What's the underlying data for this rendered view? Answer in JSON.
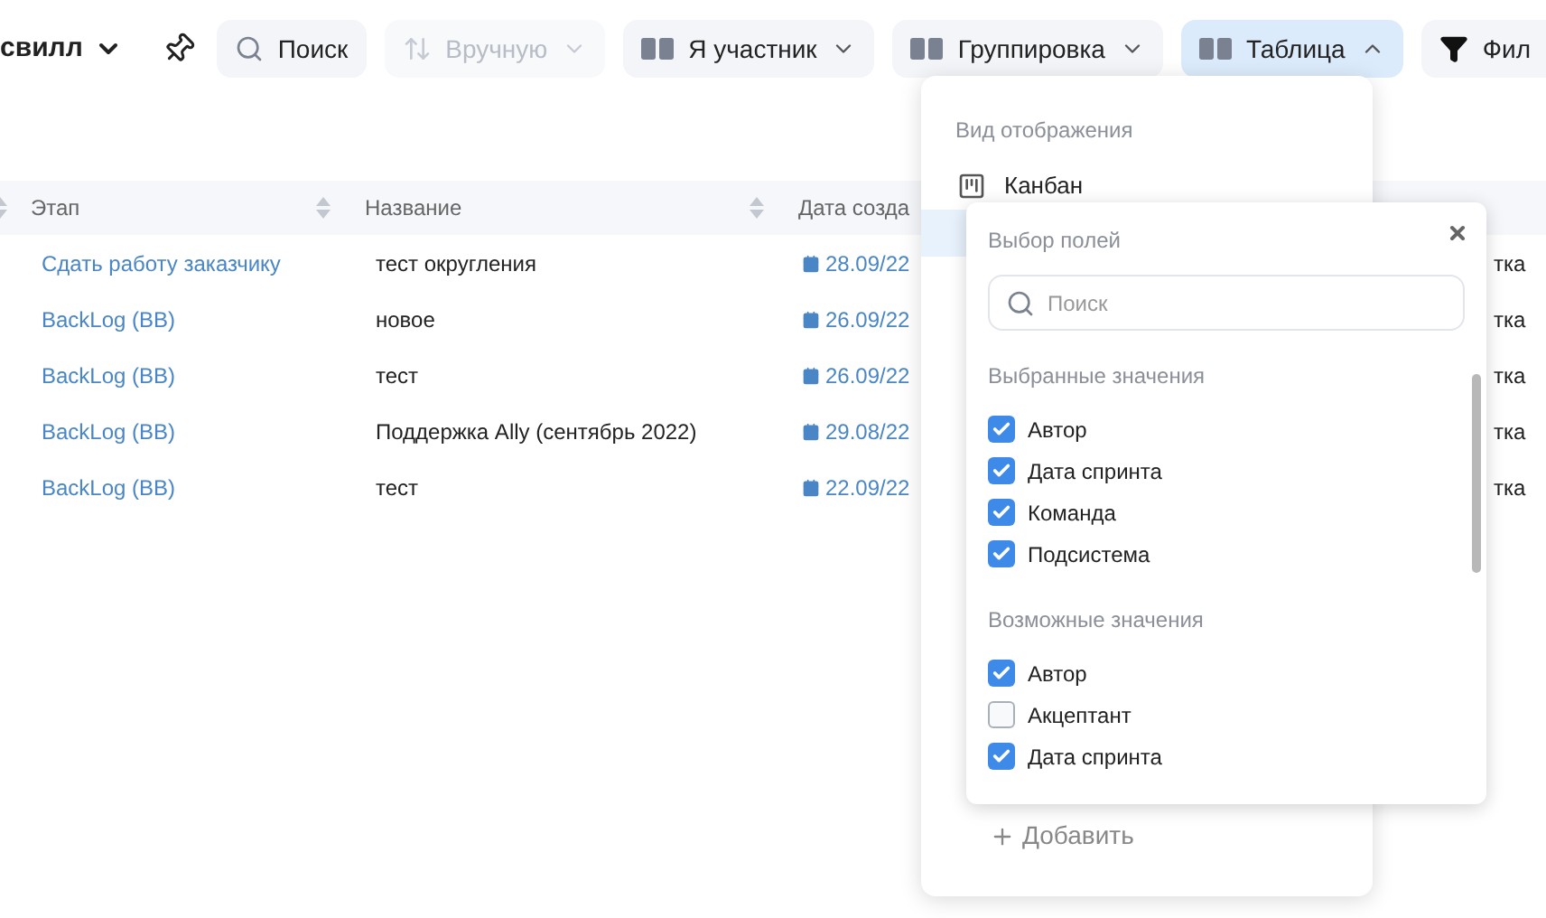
{
  "toolbar": {
    "title": "свилл",
    "buttons": [
      {
        "kind": "search",
        "label": "Поиск",
        "active": false,
        "disabled": false
      },
      {
        "kind": "sort",
        "label": "Вручную",
        "active": false,
        "disabled": true
      },
      {
        "kind": "grid",
        "label": "Я участник",
        "active": false,
        "disabled": false
      },
      {
        "kind": "grid",
        "label": "Группировка",
        "active": false,
        "disabled": false
      },
      {
        "kind": "grid",
        "label": "Таблица",
        "active": true,
        "disabled": false
      },
      {
        "kind": "filter",
        "label": "Фил",
        "active": false,
        "disabled": false
      }
    ]
  },
  "table": {
    "columns": [
      "Этап",
      "Название",
      "Дата созда"
    ],
    "rows": [
      {
        "stage": "Сдать работу заказчику",
        "name": "тест округления",
        "date": "28.09/22",
        "column_4": "тка"
      },
      {
        "stage": "BackLog (BB)",
        "name": "новое",
        "date": "26.09/22",
        "column_4": "тка"
      },
      {
        "stage": "BackLog (BB)",
        "name": "тест",
        "date": "26.09/22",
        "column_4": "тка"
      },
      {
        "stage": "BackLog (BB)",
        "name": "Поддержка Ally (сентябрь 2022)",
        "date": "29.08/22",
        "column_4": "тка"
      },
      {
        "stage": "BackLog (BB)",
        "name": "тест",
        "date": "22.09/22",
        "column_4": "тка"
      }
    ]
  },
  "view_menu": {
    "title": "Вид отображения",
    "items": [
      {
        "label": "Канбан",
        "selected": false
      },
      {
        "selected": true
      }
    ],
    "add_label": "Добавить"
  },
  "field_picker": {
    "title": "Выбор полей",
    "search": {
      "placeholder": "Поиск"
    },
    "sections": [
      {
        "title": "Выбранные значения",
        "items": [
          {
            "label": "Автор",
            "checked": true
          },
          {
            "label": "Дата спринта",
            "checked": true
          },
          {
            "label": "Команда",
            "checked": true
          },
          {
            "label": "Подсистема",
            "checked": true
          }
        ]
      },
      {
        "title": "Возможные значения",
        "items": [
          {
            "label": "Автор",
            "checked": true
          },
          {
            "label": "Акцептант",
            "checked": false
          },
          {
            "label": "Дата спринта",
            "checked": true
          }
        ]
      }
    ]
  }
}
